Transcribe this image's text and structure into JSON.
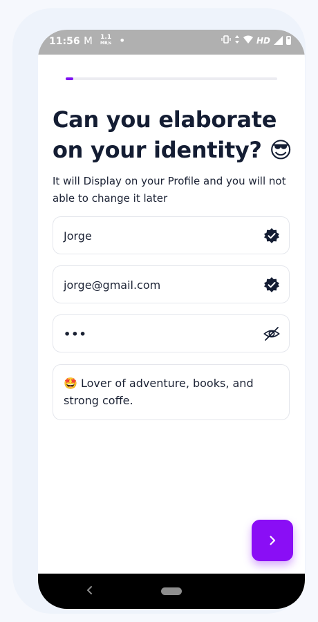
{
  "status_bar": {
    "time": "11:56",
    "gmail_icon": "gmail-icon",
    "speed_value": "1.1",
    "speed_unit": "MB/s",
    "dot": "•",
    "network_label": "HD"
  },
  "progress": {
    "fraction": 0.035,
    "color": "#7e10f2"
  },
  "title": "Can you elaborate on your identity? 😎",
  "subtitle": "It will Display on your Profile and you will not able to change it later",
  "fields": {
    "name": {
      "value": "Jorge",
      "icon": "verified-badge-icon"
    },
    "email": {
      "value": "jorge@gmail.com",
      "icon": "verified-badge-icon"
    },
    "password": {
      "value": "•••",
      "icon": "eye-off-icon"
    }
  },
  "bio": {
    "value": "🤩 Lover of adventure, books, and strong coffe."
  },
  "next_button": {
    "icon": "chevron-right-icon",
    "color": "#8a0ef5"
  },
  "nav_bar": {
    "back_icon": "back-icon",
    "home_icon": "home-pill-icon"
  }
}
